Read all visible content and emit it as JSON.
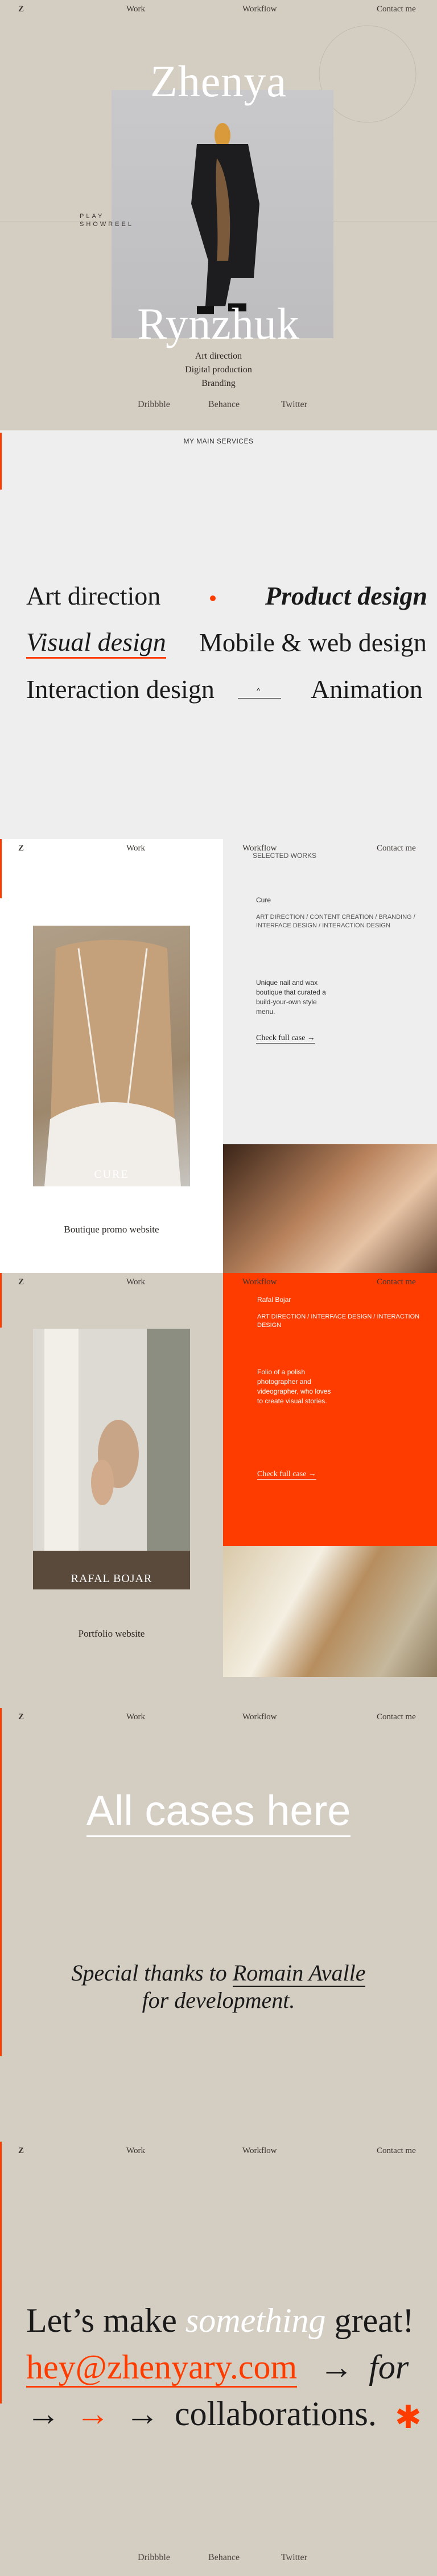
{
  "nav": {
    "logo": "Z",
    "work": "Work",
    "workflow": "Workflow",
    "contact": "Contact me"
  },
  "hero": {
    "first_name": "Zhenya",
    "last_name": "Rynzhuk",
    "showreel": [
      "PLAY",
      "SHOWREEL"
    ],
    "roles": [
      "Art direction",
      "Digital production",
      "Branding"
    ],
    "links": [
      "Dribbble",
      "Behance",
      "Twitter"
    ]
  },
  "services": {
    "heading": "MY MAIN SERVICES",
    "items": [
      "Art direction",
      "Product design",
      "Visual design",
      "Mobile & web design",
      "Interaction design",
      "Animation"
    ]
  },
  "works": {
    "heading": "SELECTED WORKS",
    "cure": {
      "title": "Cure",
      "tags": "ART DIRECTION / CONTENT CREATION / BRANDING / INTERFACE DESIGN / INTERACTION DESIGN",
      "desc": "Unique nail and wax boutique that curated a build-your-own style menu.",
      "cta": "Check full case →",
      "image_label": "CURE",
      "caption": "Boutique promo website"
    },
    "rafal": {
      "title": "Rafal Bojar",
      "tags": "ART DIRECTION / INTERFACE DESIGN / INTERACTION DESIGN",
      "desc": "Folio of a polish photographer and videographer, who loves to create visual stories.",
      "cta": "Check full case →",
      "image_label": "RAFAL BOJAR",
      "caption": "Portfolio website"
    }
  },
  "cases": {
    "link": "All cases here",
    "thanks_prefix": "Special thanks to ",
    "thanks_name": "Romain Avalle",
    "thanks_suffix": "for development."
  },
  "contact": {
    "line1_a": "Let’s make ",
    "line1_b": "something",
    "line1_c": " great!",
    "email": "hey@zhenyary.com",
    "line2_for": "for",
    "line3": "collaborations.",
    "links": [
      "Dribbble",
      "Behance",
      "Twitter"
    ]
  },
  "colors": {
    "accent": "#ff3c00",
    "beige": "#d4cdc2",
    "light": "#efeeee"
  }
}
